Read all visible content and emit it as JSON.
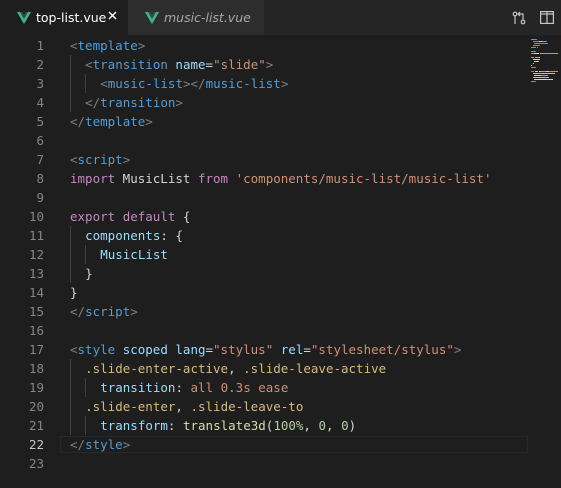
{
  "tabs": [
    {
      "label": "top-list.vue",
      "active": true
    },
    {
      "label": "music-list.vue",
      "active": false
    }
  ],
  "icons": {
    "file_icon": "vue-logo-icon",
    "close": "close-icon",
    "compare": "open-changes-icon",
    "split": "split-editor-icon"
  },
  "colors": {
    "background": "#1e1e1e",
    "tab_bar": "#252526",
    "vue_green": "#41b883"
  },
  "current_line": 22,
  "lines": [
    {
      "n": "1",
      "indent": 0,
      "tokens": [
        [
          "t-punc",
          "<"
        ],
        [
          "t-tag",
          "template"
        ],
        [
          "t-punc",
          ">"
        ]
      ]
    },
    {
      "n": "2",
      "indent": 1,
      "tokens": [
        [
          "t-punc",
          "<"
        ],
        [
          "t-tag",
          "transition"
        ],
        [
          "t-text",
          " "
        ],
        [
          "t-attr",
          "name"
        ],
        [
          "t-text",
          "="
        ],
        [
          "t-str",
          "\"slide\""
        ],
        [
          "t-punc",
          ">"
        ]
      ]
    },
    {
      "n": "3",
      "indent": 2,
      "tokens": [
        [
          "t-punc",
          "<"
        ],
        [
          "t-tag",
          "music-list"
        ],
        [
          "t-punc",
          "></"
        ],
        [
          "t-tag",
          "music-list"
        ],
        [
          "t-punc",
          ">"
        ]
      ]
    },
    {
      "n": "4",
      "indent": 1,
      "tokens": [
        [
          "t-punc",
          "</"
        ],
        [
          "t-tag",
          "transition"
        ],
        [
          "t-punc",
          ">"
        ]
      ]
    },
    {
      "n": "5",
      "indent": 0,
      "tokens": [
        [
          "t-punc",
          "</"
        ],
        [
          "t-tag",
          "template"
        ],
        [
          "t-punc",
          ">"
        ]
      ]
    },
    {
      "n": "6",
      "indent": 0,
      "tokens": []
    },
    {
      "n": "7",
      "indent": 0,
      "tokens": [
        [
          "t-punc",
          "<"
        ],
        [
          "t-tag",
          "script"
        ],
        [
          "t-punc",
          ">"
        ]
      ]
    },
    {
      "n": "8",
      "indent": 0,
      "tokens": [
        [
          "t-kw",
          "import"
        ],
        [
          "t-text",
          " MusicList "
        ],
        [
          "t-kw",
          "from"
        ],
        [
          "t-text",
          " "
        ],
        [
          "t-str",
          "'components/music-list/music-list'"
        ]
      ]
    },
    {
      "n": "9",
      "indent": 0,
      "tokens": []
    },
    {
      "n": "10",
      "indent": 0,
      "tokens": [
        [
          "t-kw",
          "export"
        ],
        [
          "t-text",
          " "
        ],
        [
          "t-kw",
          "default"
        ],
        [
          "t-text",
          " {"
        ]
      ]
    },
    {
      "n": "11",
      "indent": 1,
      "tokens": [
        [
          "t-attr",
          "components"
        ],
        [
          "t-text",
          ": {"
        ]
      ]
    },
    {
      "n": "12",
      "indent": 2,
      "tokens": [
        [
          "t-attr",
          "MusicList"
        ]
      ]
    },
    {
      "n": "13",
      "indent": 1,
      "tokens": [
        [
          "t-text",
          "}"
        ]
      ]
    },
    {
      "n": "14",
      "indent": 0,
      "tokens": [
        [
          "t-text",
          "}"
        ]
      ]
    },
    {
      "n": "15",
      "indent": 0,
      "tokens": [
        [
          "t-punc",
          "</"
        ],
        [
          "t-tag",
          "script"
        ],
        [
          "t-punc",
          ">"
        ]
      ]
    },
    {
      "n": "16",
      "indent": 0,
      "tokens": []
    },
    {
      "n": "17",
      "indent": 0,
      "tokens": [
        [
          "t-punc",
          "<"
        ],
        [
          "t-tag",
          "style"
        ],
        [
          "t-text",
          " "
        ],
        [
          "t-attr",
          "scoped"
        ],
        [
          "t-text",
          " "
        ],
        [
          "t-attr",
          "lang"
        ],
        [
          "t-text",
          "="
        ],
        [
          "t-str",
          "\"stylus\""
        ],
        [
          "t-text",
          " "
        ],
        [
          "t-attr",
          "rel"
        ],
        [
          "t-text",
          "="
        ],
        [
          "t-str",
          "\"stylesheet/stylus\""
        ],
        [
          "t-punc",
          ">"
        ]
      ]
    },
    {
      "n": "18",
      "indent": 1,
      "tokens": [
        [
          "t-sel",
          ".slide-enter-active"
        ],
        [
          "t-text",
          ", "
        ],
        [
          "t-sel",
          ".slide-leave-active"
        ]
      ]
    },
    {
      "n": "19",
      "indent": 2,
      "tokens": [
        [
          "t-attr",
          "transition"
        ],
        [
          "t-text",
          ": "
        ],
        [
          "t-str",
          "all 0.3s ease"
        ]
      ]
    },
    {
      "n": "20",
      "indent": 1,
      "tokens": [
        [
          "t-sel",
          ".slide-enter"
        ],
        [
          "t-text",
          ", "
        ],
        [
          "t-sel",
          ".slide-leave-to"
        ]
      ]
    },
    {
      "n": "21",
      "indent": 2,
      "tokens": [
        [
          "t-attr",
          "transform"
        ],
        [
          "t-text",
          ": "
        ],
        [
          "t-fn",
          "translate3d"
        ],
        [
          "t-text",
          "("
        ],
        [
          "t-num",
          "100%"
        ],
        [
          "t-text",
          ", "
        ],
        [
          "t-num",
          "0"
        ],
        [
          "t-text",
          ", "
        ],
        [
          "t-num",
          "0"
        ],
        [
          "t-text",
          ")"
        ]
      ]
    },
    {
      "n": "22",
      "indent": 0,
      "tokens": [
        [
          "t-punc",
          "</"
        ],
        [
          "t-tag",
          "style"
        ],
        [
          "t-punc",
          ">"
        ]
      ]
    },
    {
      "n": "23",
      "indent": 0,
      "tokens": []
    }
  ]
}
